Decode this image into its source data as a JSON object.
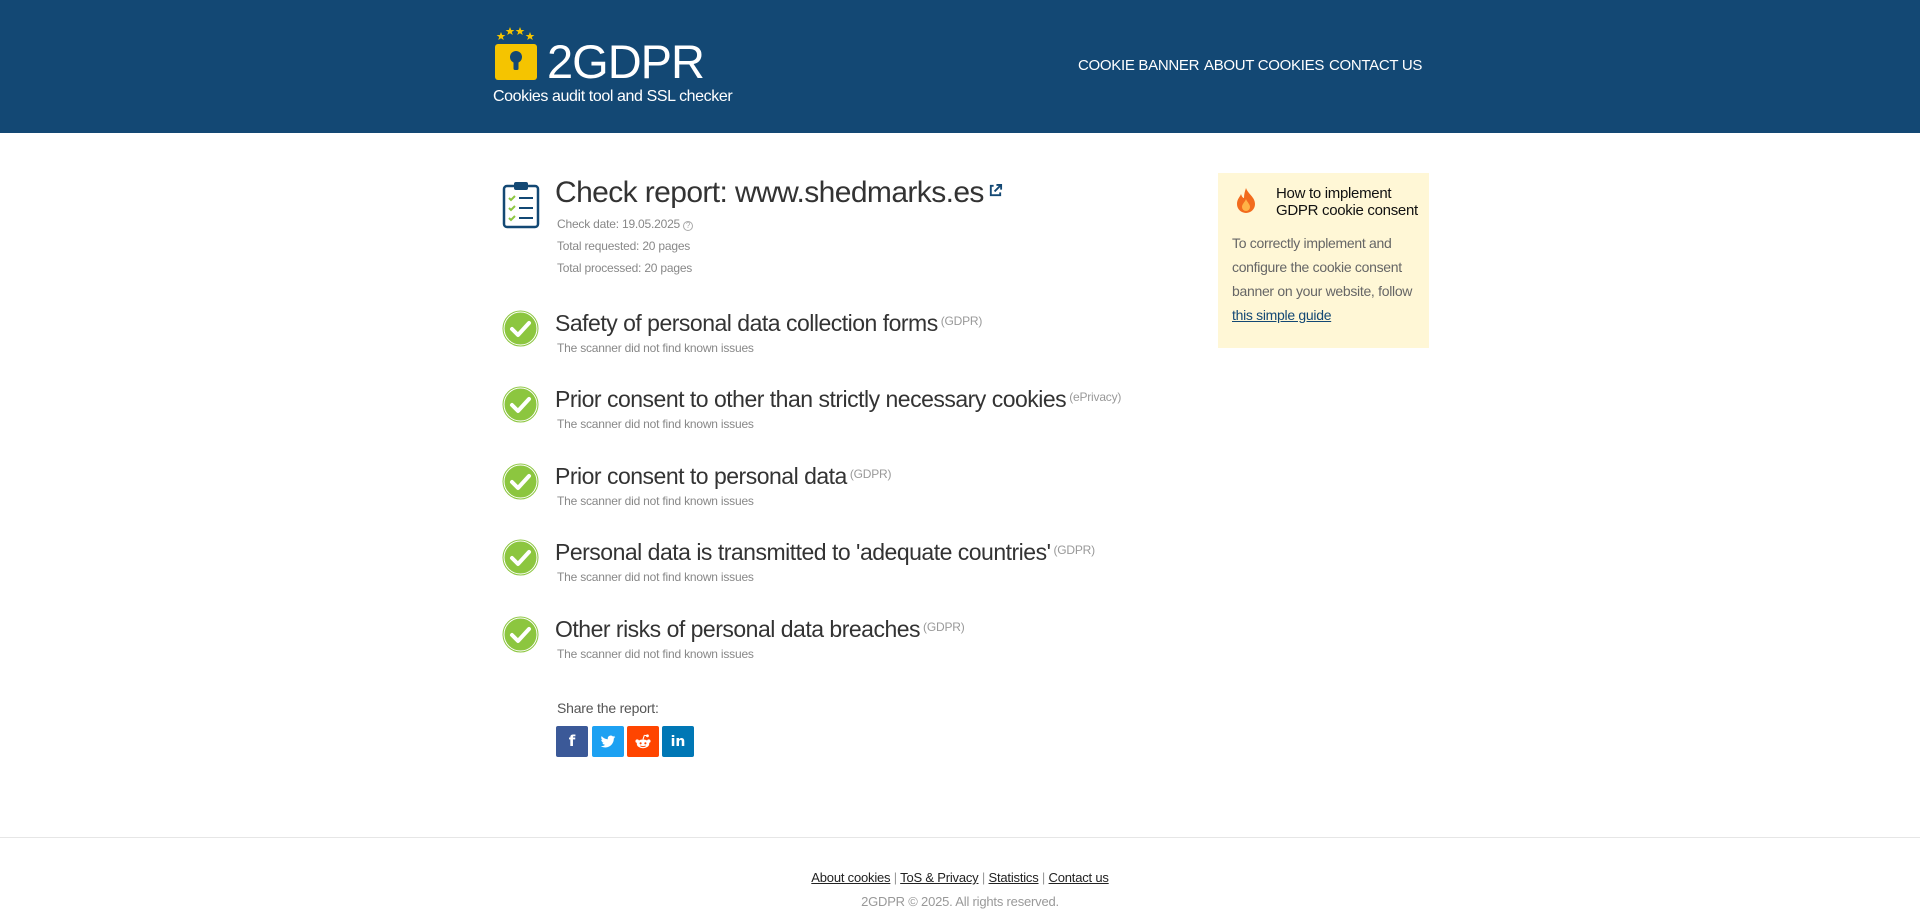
{
  "header": {
    "logo_text": "2GDPR",
    "tagline": "Cookies audit tool and SSL checker",
    "nav": [
      "COOKIE BANNER",
      "ABOUT COOKIES",
      "CONTACT US"
    ]
  },
  "report": {
    "title": "Check report: www.shedmarks.es",
    "check_date": "Check date: 19.05.2025",
    "total_requested": "Total requested: 20 pages",
    "total_processed": "Total processed: 20 pages"
  },
  "checks": [
    {
      "title": "Safety of personal data collection forms",
      "tag": "(GDPR)",
      "status": "The scanner did not find known issues"
    },
    {
      "title": "Prior consent to other than strictly necessary cookies",
      "tag": "(ePrivacy)",
      "status": "The scanner did not find known issues"
    },
    {
      "title": "Prior consent to personal data",
      "tag": "(GDPR)",
      "status": "The scanner did not find known issues"
    },
    {
      "title": "Personal data is transmitted to 'adequate countries'",
      "tag": "(GDPR)",
      "status": "The scanner did not find known issues"
    },
    {
      "title": "Other risks of personal data breaches",
      "tag": "(GDPR)",
      "status": "The scanner did not find known issues"
    }
  ],
  "share": {
    "label": "Share the report:",
    "buttons": [
      "facebook-icon",
      "twitter-icon",
      "reddit-icon",
      "linkedin-icon"
    ]
  },
  "sidebar": {
    "title": "How to implement GDPR cookie consent",
    "body": "To correctly implement and configure the cookie consent banner on your website, follow",
    "link": "this simple guide"
  },
  "footer": {
    "links": [
      "About cookies",
      "ToS & Privacy",
      "Statistics",
      "Contact us"
    ],
    "copyright": "2GDPR © 2025. All rights reserved."
  },
  "colors": {
    "header_bg": "#134874",
    "check_green": "#8cc63f",
    "card_bg": "#fff7d6",
    "facebook": "#3b5998",
    "twitter": "#1da1f2",
    "reddit": "#ff4500",
    "linkedin": "#0077b5"
  }
}
